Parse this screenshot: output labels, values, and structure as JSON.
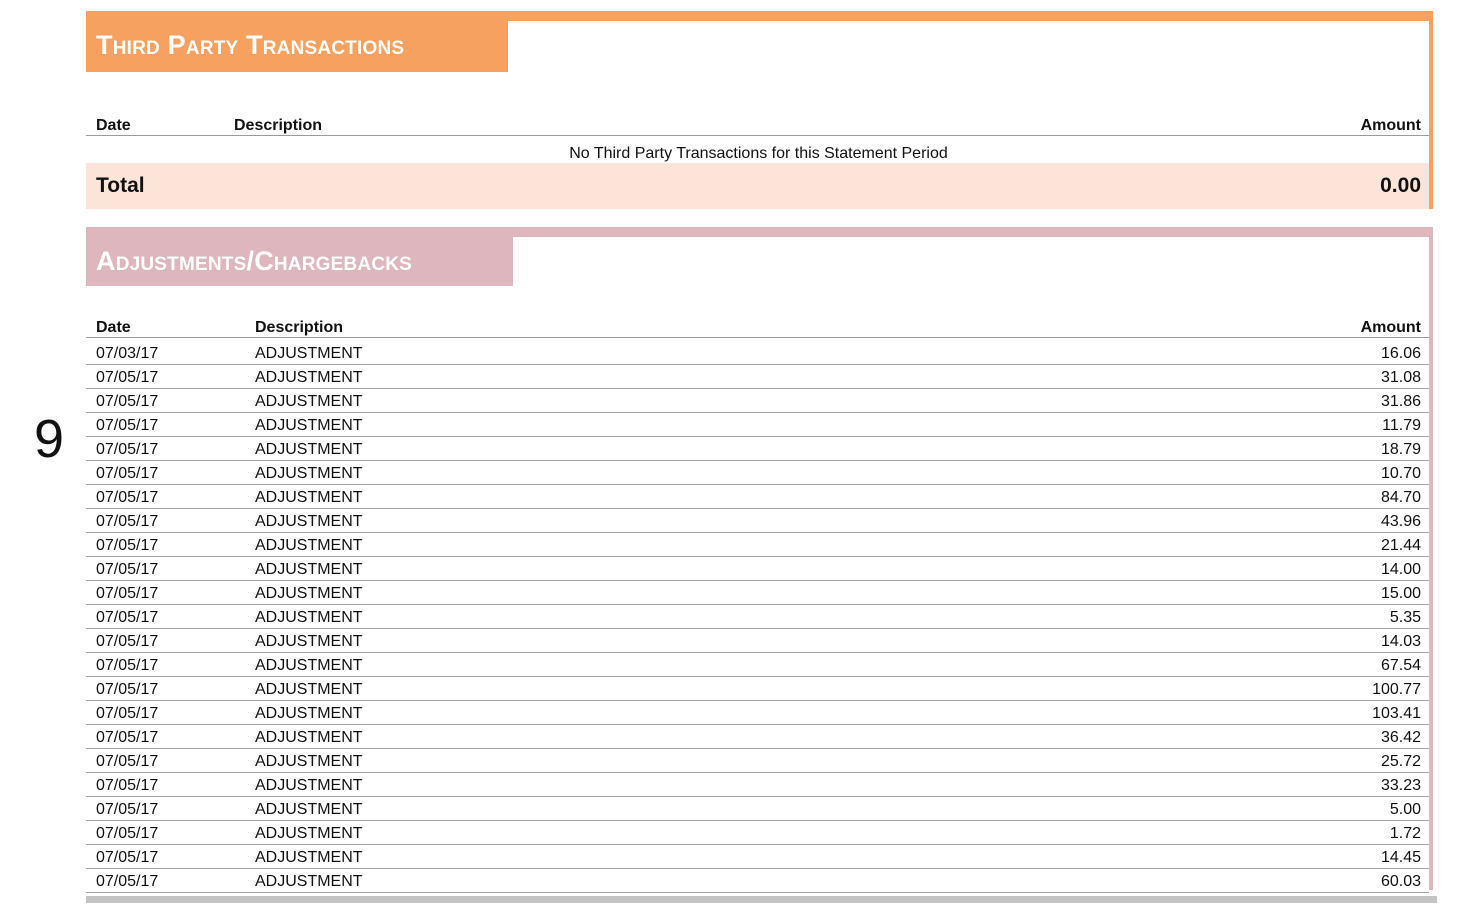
{
  "page": {
    "number": "9"
  },
  "third_party": {
    "title": "Third Party Transactions",
    "columns": {
      "date": "Date",
      "description": "Description",
      "amount": "Amount"
    },
    "empty_message": "No Third Party Transactions for this Statement Period",
    "total_label": "Total",
    "total_value": "0.00"
  },
  "adjustments": {
    "title": "Adjustments/Chargebacks",
    "columns": {
      "date": "Date",
      "description": "Description",
      "amount": "Amount"
    },
    "rows": [
      {
        "date": "07/03/17",
        "description": "ADJUSTMENT",
        "amount": "16.06"
      },
      {
        "date": "07/05/17",
        "description": "ADJUSTMENT",
        "amount": "31.08"
      },
      {
        "date": "07/05/17",
        "description": "ADJUSTMENT",
        "amount": "31.86"
      },
      {
        "date": "07/05/17",
        "description": "ADJUSTMENT",
        "amount": "11.79"
      },
      {
        "date": "07/05/17",
        "description": "ADJUSTMENT",
        "amount": "18.79"
      },
      {
        "date": "07/05/17",
        "description": "ADJUSTMENT",
        "amount": "10.70"
      },
      {
        "date": "07/05/17",
        "description": "ADJUSTMENT",
        "amount": "84.70"
      },
      {
        "date": "07/05/17",
        "description": "ADJUSTMENT",
        "amount": "43.96"
      },
      {
        "date": "07/05/17",
        "description": "ADJUSTMENT",
        "amount": "21.44"
      },
      {
        "date": "07/05/17",
        "description": "ADJUSTMENT",
        "amount": "14.00"
      },
      {
        "date": "07/05/17",
        "description": "ADJUSTMENT",
        "amount": "15.00"
      },
      {
        "date": "07/05/17",
        "description": "ADJUSTMENT",
        "amount": "5.35"
      },
      {
        "date": "07/05/17",
        "description": "ADJUSTMENT",
        "amount": "14.03"
      },
      {
        "date": "07/05/17",
        "description": "ADJUSTMENT",
        "amount": "67.54"
      },
      {
        "date": "07/05/17",
        "description": "ADJUSTMENT",
        "amount": "100.77"
      },
      {
        "date": "07/05/17",
        "description": "ADJUSTMENT",
        "amount": "103.41"
      },
      {
        "date": "07/05/17",
        "description": "ADJUSTMENT",
        "amount": "36.42"
      },
      {
        "date": "07/05/17",
        "description": "ADJUSTMENT",
        "amount": "25.72"
      },
      {
        "date": "07/05/17",
        "description": "ADJUSTMENT",
        "amount": "33.23"
      },
      {
        "date": "07/05/17",
        "description": "ADJUSTMENT",
        "amount": "5.00"
      },
      {
        "date": "07/05/17",
        "description": "ADJUSTMENT",
        "amount": "1.72"
      },
      {
        "date": "07/05/17",
        "description": "ADJUSTMENT",
        "amount": "14.45"
      },
      {
        "date": "07/05/17",
        "description": "ADJUSTMENT",
        "amount": "60.03"
      }
    ]
  },
  "colors": {
    "third_party_accent": "#f6a15f",
    "third_party_total_bg": "#fce4d9",
    "adjustments_accent": "#deb6bd"
  }
}
